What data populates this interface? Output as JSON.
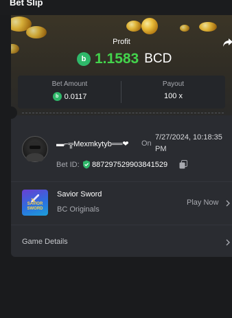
{
  "header": {
    "title": "Bet Slip"
  },
  "profit": {
    "label": "Profit",
    "value": "1.1583",
    "currency": "BCD"
  },
  "stats": {
    "bet_amount_label": "Bet Amount",
    "bet_amount_value": "0.0117",
    "payout_label": "Payout",
    "payout_value": "100 x"
  },
  "user": {
    "username": "▬⌐╦Mexmkytyb══❤",
    "on_label": "On",
    "date": "7/27/2024, 10:18:35 PM",
    "bet_id_label": "Bet ID:",
    "bet_id_value": "887297529903841529"
  },
  "game": {
    "thumb_text": "SAVIOR SWORD",
    "name": "Savior Sword",
    "provider": "BC Originals",
    "play_label": "Play Now"
  },
  "details": {
    "label": "Game Details"
  },
  "icons": {
    "currency": "bc-coin-icon",
    "share": "share-icon",
    "shield": "verified-shield-icon",
    "copy": "copy-icon",
    "chevron": "chevron-right-icon"
  },
  "colors": {
    "profit_green": "#43d34c",
    "coin_green": "#2fb86a",
    "card_bg": "#2a2c31"
  }
}
